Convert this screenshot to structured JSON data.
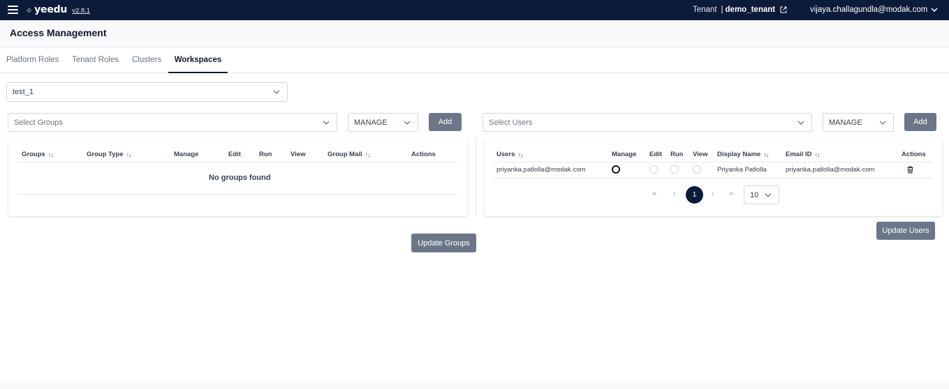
{
  "topbar": {
    "logo_mark": "⟐",
    "logo_text": "yeedu",
    "version": "v2.8.1",
    "tenant_label": "Tenant",
    "tenant_name": "demo_tenant",
    "user_email": "vijaya.challagundla@modak.com"
  },
  "page": {
    "title": "Access Management"
  },
  "tabs": [
    {
      "label": "Platform Roles"
    },
    {
      "label": "Tenant Roles"
    },
    {
      "label": "Clusters"
    },
    {
      "label": "Workspaces"
    }
  ],
  "active_tab": "Workspaces",
  "workspace_select": {
    "value": "test_1"
  },
  "groups": {
    "select_placeholder": "Select Groups",
    "permission_value": "MANAGE",
    "add_label": "Add",
    "columns": [
      "Groups",
      "Group Type",
      "Manage",
      "Edit",
      "Run",
      "View",
      "Group Mail",
      "Actions"
    ],
    "empty_text": "No groups found",
    "update_label": "Update Groups"
  },
  "users": {
    "select_placeholder": "Select Users",
    "permission_value": "MANAGE",
    "add_label": "Add",
    "columns": [
      "Users",
      "Manage",
      "Edit",
      "Run",
      "View",
      "Display Name",
      "Email ID",
      "Actions"
    ],
    "rows": [
      {
        "user": "priyanka.patlolla@modak.com",
        "permission": "Manage",
        "display_name": "Priyanka Patlolla",
        "email": "priyanka.patlolla@modak.com"
      }
    ],
    "pagination": {
      "first": "«",
      "prev": "‹",
      "current_page": "1",
      "next": "›",
      "last": "»",
      "page_size": "10"
    },
    "update_label": "Update Users"
  },
  "colors": {
    "navbar": "#0c1b3a",
    "button": "#6b7789",
    "accent": "#0c1b3a"
  }
}
